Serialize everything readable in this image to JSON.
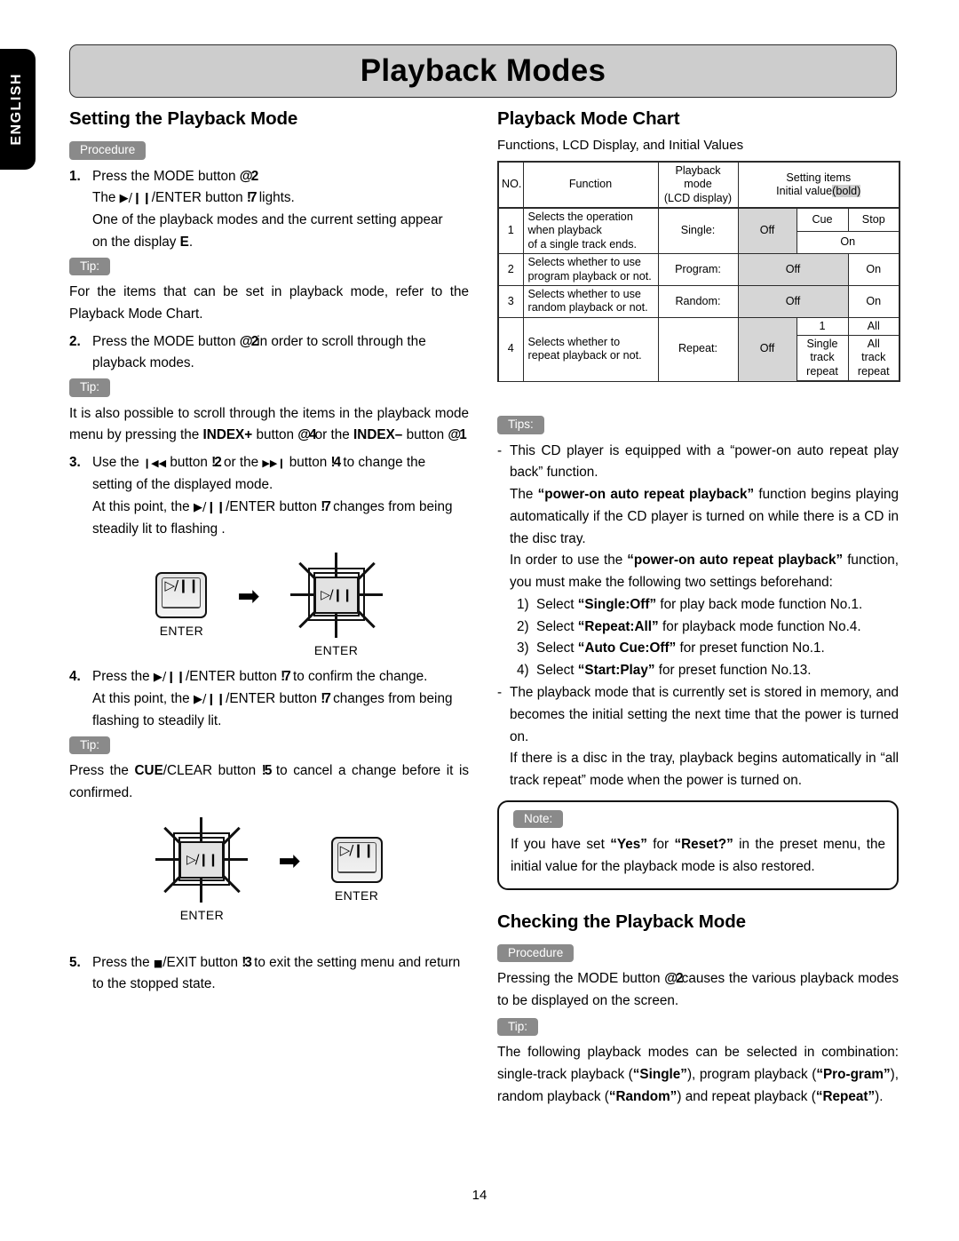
{
  "language_tab": "ENGLISH",
  "page_title": "Playback Modes",
  "page_number": "14",
  "left_column": {
    "heading": "Setting the Playback Mode",
    "procedure_badge": "Procedure",
    "step1": {
      "num": "1.",
      "line1_pre": "Press the MODE button",
      "line1_ref": "@2",
      "line2_pre": "The",
      "line2_glyph": "▶/❙❙",
      "line2_mid": "/ENTER button",
      "line2_ref": "!7",
      "line2_post": "lights.",
      "line3": "One of the playback modes and the current setting appear",
      "line4_pre": "on the display",
      "line4_bold": "E",
      "line4_post": "."
    },
    "tip1_badge": "Tip:",
    "tip1_text": "For the items that can be set in playback mode, refer to the Playback Mode Chart.",
    "step2": {
      "num": "2.",
      "pre": "Press the MODE button",
      "ref": "@2",
      "post": "in order to scroll through the playback modes."
    },
    "tip2_badge": "Tip:",
    "tip2": {
      "pre": "It is also possible to scroll through the items in the playback mode menu by pressing the",
      "bold1": "INDEX+",
      "mid1": "button",
      "ref1": "@4",
      "mid2": "or the",
      "bold2": "INDEX–",
      "mid3": "button",
      "ref2": "@1"
    },
    "step3": {
      "num": "3.",
      "pre": "Use the",
      "glyph1": "❙◀◀",
      "mid1": "button",
      "ref1": "!2",
      "mid2": "or the",
      "glyph2": "▶▶❙",
      "mid3": "button",
      "ref2": "!4",
      "post": "to change the setting of the displayed mode.",
      "line2_pre": "At this point, the",
      "line2_glyph": "▶/❙❙",
      "line2_mid": "/ENTER button",
      "line2_ref": "!7",
      "line2_post": "changes from being steadily lit to flashing ."
    },
    "diagram1": {
      "key_glyph": "▷/❙❙",
      "left_label": "ENTER",
      "arrow": "➡",
      "right_label": "ENTER"
    },
    "step4": {
      "num": "4.",
      "pre": "Press the",
      "glyph": "▶/❙❙",
      "mid": "/ENTER button",
      "ref": "!7",
      "post": "to confirm the change.",
      "line2_pre": "At this point, the",
      "line2_glyph": "▶/❙❙",
      "line2_mid": "/ENTER button",
      "line2_ref": "!7",
      "line2_post": "changes from being flashing to steadily lit."
    },
    "tip3_badge": "Tip:",
    "tip3": {
      "pre": "Press the",
      "bold": "CUE",
      "mid": "/CLEAR button",
      "ref": "!5",
      "post": "to cancel a change before it is confirmed."
    },
    "diagram2": {
      "key_glyph": "▷/❙❙",
      "left_label": "ENTER",
      "arrow": "➡",
      "right_label": "ENTER"
    },
    "step5": {
      "num": "5.",
      "pre": "Press the",
      "glyph": "■",
      "mid": "/EXIT button",
      "ref": "!3",
      "post": "to exit the setting menu and return to the stopped state."
    }
  },
  "right_column": {
    "heading": "Playback Mode Chart",
    "subheading": "Functions, LCD Display, and Initial Values",
    "tips_badge": "Tips:",
    "tip_a": {
      "line1": "This CD player is equipped with a “power-on auto repeat play back” function.",
      "line2_pre": "The",
      "line2_bold": "“power-on auto repeat playback”",
      "line2_post": "function begins playing automatically if the CD player is turned on while there is a CD in the disc tray.",
      "line3_pre": "In order to use the",
      "line3_bold": "“power-on auto repeat playback”",
      "line3_post": "function, you must make the following two settings beforehand:",
      "items": [
        {
          "n": "1)",
          "pre": "Select",
          "bold": "“Single:Off”",
          "post": "for play back mode function No.1."
        },
        {
          "n": "2)",
          "pre": "Select",
          "bold": "“Repeat:All”",
          "post": "for playback mode function No.4."
        },
        {
          "n": "3)",
          "pre": "Select",
          "bold": "“Auto Cue:Off”",
          "post": "for preset function No.1."
        },
        {
          "n": "4)",
          "pre": "Select",
          "bold": "“Start:Play”",
          "post": "for preset function No.13."
        }
      ]
    },
    "tip_b": {
      "line1": "The playback mode that is currently set is stored in memory, and becomes the initial setting the next time that the power is turned on.",
      "line2": "If there is a disc in the tray, playback begins automatically in “all track repeat” mode when the power is turned on."
    },
    "note_badge": "Note:",
    "note_text": {
      "pre": "If you have set",
      "bold1": "“Yes”",
      "mid": "for",
      "bold2": "“Reset?”",
      "post": "in the preset menu, the initial value for the playback mode is also restored."
    },
    "heading2": "Checking the Playback Mode",
    "procedure_badge": "Procedure",
    "procedure_text": {
      "pre": "Pressing the MODE button",
      "ref": "@2",
      "post": "causes the various playback modes to be displayed on the screen."
    },
    "tip4_badge": "Tip:",
    "tip4": {
      "pre": "The following playback modes can be selected in combination: single-track playback (",
      "b1": "“Single”",
      "m1": "), program playback (",
      "b2": "“Pro-gram”",
      "m2": "), random playback (",
      "b3": "“Random”",
      "m3": ") and repeat playback (",
      "b4": "“Repeat”",
      "m4": ")."
    }
  },
  "chart_data": {
    "type": "table",
    "title": "Playback Mode Chart",
    "subtitle": "Functions, LCD Display, and Initial Values",
    "headers": {
      "no": "NO.",
      "function": "Function",
      "playback_mode_l1": "Playback mode",
      "playback_mode_l2": "(LCD display)",
      "setting_items_l1": "Setting items",
      "setting_items_l2_pre": "Initial value",
      "setting_items_l2_bold": "(bold)"
    },
    "rows": [
      {
        "no": "1",
        "function": "Selects the operation when playback of a single track ends.",
        "function_lines": [
          "Selects the operation",
          "when playback",
          "of a single track ends."
        ],
        "playback_mode": "Single:",
        "initial_value": "Off",
        "settings_top": [
          "Cue",
          "Stop"
        ],
        "settings_bottom": [
          "On"
        ]
      },
      {
        "no": "2",
        "function": "Selects whether to use program playback or not.",
        "function_lines": [
          "Selects whether to use",
          "program playback or not."
        ],
        "playback_mode": "Program:",
        "initial_value": "Off",
        "settings_top": [
          "On"
        ],
        "settings_bottom": []
      },
      {
        "no": "3",
        "function": "Selects whether to use random playback or not.",
        "function_lines": [
          "Selects whether to use",
          "random playback or not."
        ],
        "playback_mode": "Random:",
        "initial_value": "Off",
        "settings_top": [
          "On"
        ],
        "settings_bottom": []
      },
      {
        "no": "4",
        "function": "Selects whether to repeat playback or not.",
        "function_lines": [
          "Selects whether to",
          "repeat playback or not."
        ],
        "playback_mode": "Repeat:",
        "initial_value": "Off",
        "settings_top": [
          "1",
          "All"
        ],
        "settings_bottom": [
          "Single track repeat",
          "All track repeat"
        ],
        "settings_bottom_lines": [
          [
            "Single",
            "track repeat"
          ],
          [
            "All",
            "track repeat"
          ]
        ]
      }
    ]
  }
}
